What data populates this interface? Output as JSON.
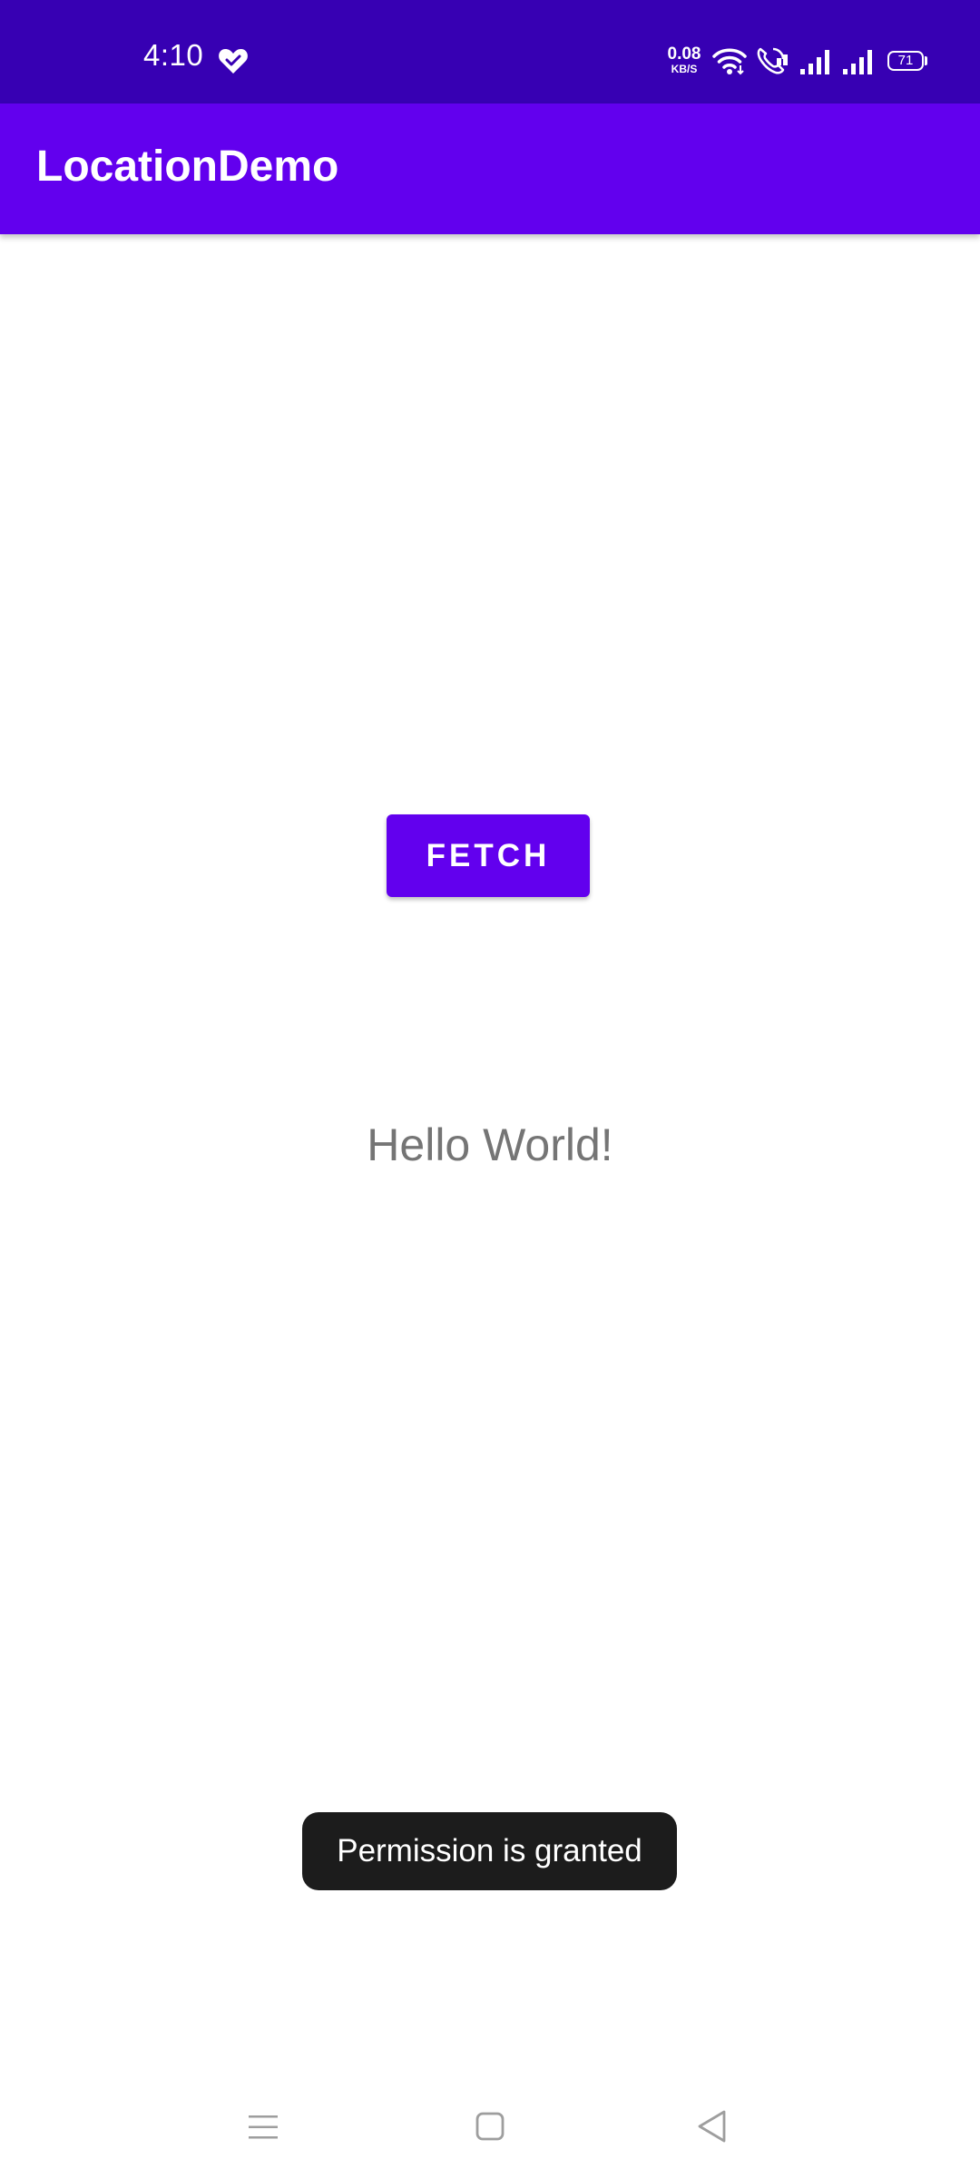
{
  "status_bar": {
    "time": "4:10",
    "net_speed_value": "0.08",
    "net_speed_unit": "KB/S",
    "battery_level": "71",
    "icons": [
      "heart-icon",
      "wifi-icon",
      "call-icon",
      "signal-icon",
      "signal-icon",
      "battery-icon"
    ]
  },
  "app_bar": {
    "title": "LocationDemo"
  },
  "main": {
    "fetch_label": "FETCH",
    "hello_text": "Hello World!"
  },
  "toast": {
    "message": "Permission is granted"
  },
  "nav_bar": {
    "icons": [
      "menu-icon",
      "home-icon",
      "back-icon"
    ]
  },
  "colors": {
    "status_bar": "#3700b3",
    "primary": "#6200ee",
    "toast_bg": "#1c1c1c",
    "hello_text": "#757575"
  }
}
